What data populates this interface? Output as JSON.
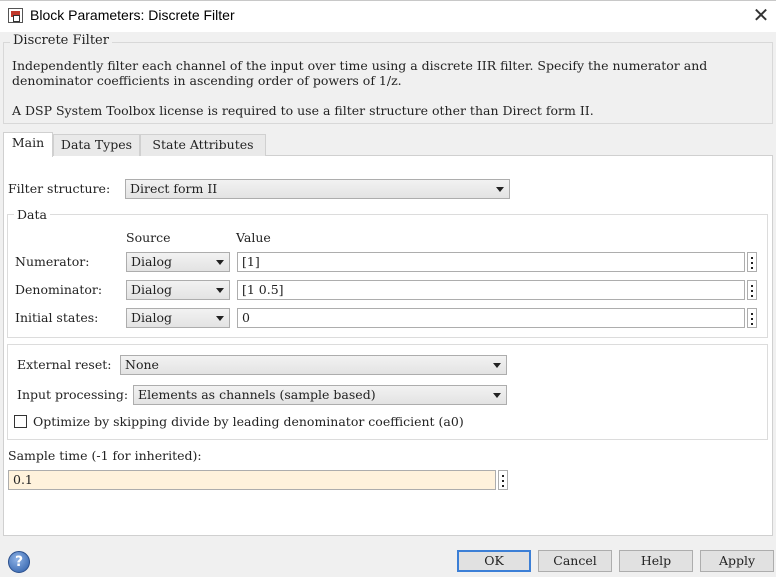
{
  "window": {
    "title": "Block Parameters: Discrete Filter",
    "close_glyph": "✕",
    "app_icon": "simulink-block-icon"
  },
  "description": {
    "legend": "Discrete Filter",
    "line1": "Independently filter each channel of the input over time using a discrete IIR filter. Specify the numerator and",
    "line2": "denominator coefficients in ascending order of powers of 1/z.",
    "line3": "A DSP System Toolbox license is required to use a filter structure other than Direct form II."
  },
  "tabs": [
    {
      "label": "Main",
      "active": true
    },
    {
      "label": "Data Types",
      "active": false
    },
    {
      "label": "State Attributes",
      "active": false
    }
  ],
  "main": {
    "filter_structure_label": "Filter structure:",
    "filter_structure_value": "Direct form II",
    "data_group": {
      "legend": "Data",
      "source_header": "Source",
      "value_header": "Value",
      "rows": [
        {
          "label": "Numerator:",
          "source": "Dialog",
          "value": "[1]"
        },
        {
          "label": "Denominator:",
          "source": "Dialog",
          "value": "[1 0.5]"
        },
        {
          "label": "Initial states:",
          "source": "Dialog",
          "value": "0"
        }
      ]
    },
    "external_reset_label": "External reset:",
    "external_reset_value": "None",
    "input_processing_label": "Input processing:",
    "input_processing_value": "Elements as channels (sample based)",
    "optimize_label": "Optimize by skipping divide by leading denominator coefficient (a0)",
    "optimize_checked": false,
    "sample_time_label": "Sample time (-1 for inherited):",
    "sample_time_value": "0.1"
  },
  "buttons": {
    "help_icon": "question-mark-icon",
    "help_glyph": "?",
    "ok": "OK",
    "cancel": "Cancel",
    "help": "Help",
    "apply": "Apply"
  },
  "colors": {
    "default_button_border": "#3c7fd6",
    "highlight_field": "#fff2dc"
  }
}
